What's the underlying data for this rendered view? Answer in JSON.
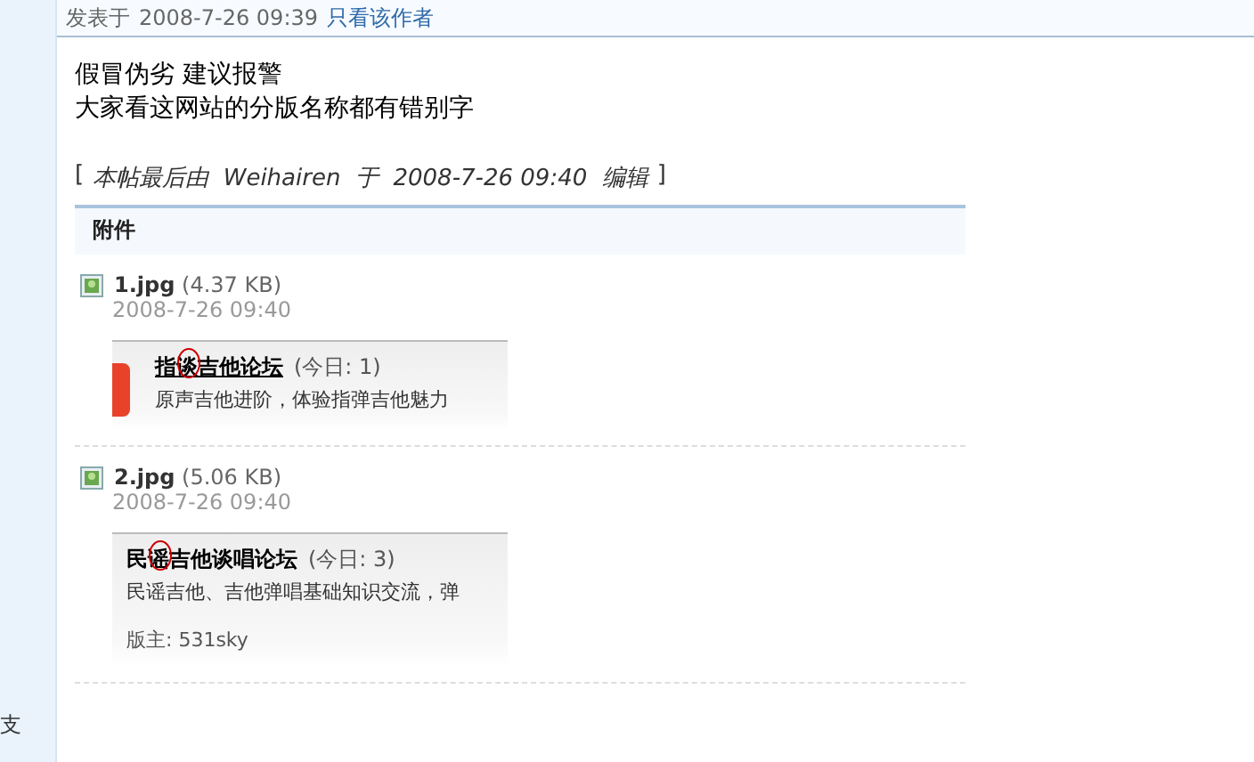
{
  "sidebar": {
    "text": "支"
  },
  "post_header": {
    "label": "发表于",
    "time": "2008-7-26 09:39",
    "author_link": "只看该作者"
  },
  "body": [
    "假冒伪劣  建议报警",
    "大家看这网站的分版名称都有错别字"
  ],
  "edit_note": {
    "open": "[",
    "text": "本帖最后由  Weihairen  于  2008-7-26 09:40  编辑",
    "close": "]"
  },
  "attachments": {
    "title": "附件",
    "items": [
      {
        "name": "1.jpg",
        "size": "(4.37 KB)",
        "date": "2008-7-26 09:40",
        "shot": {
          "title": "指谈吉他论坛",
          "today": "(今日: 1)",
          "desc": "原声吉他进阶，体验指弹吉他魅力",
          "logo": true,
          "underline": true
        }
      },
      {
        "name": "2.jpg",
        "size": "(5.06 KB)",
        "date": "2008-7-26 09:40",
        "shot": {
          "title": "民谣吉他谈唱论坛",
          "today": "(今日: 3)",
          "desc": "民谣吉他、吉他弹唱基础知识交流，弹",
          "moderator": "版主: 531sky",
          "logo": false,
          "underline": false
        }
      }
    ]
  }
}
